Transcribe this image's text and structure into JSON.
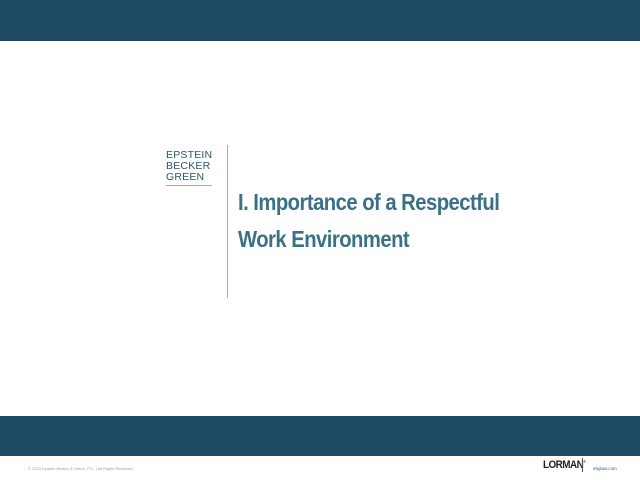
{
  "header": {
    "bar_color": "#1f4a63"
  },
  "logo": {
    "lines": [
      "EPSTEIN",
      "BECKER",
      "GREEN"
    ],
    "color": "#2a5670",
    "accent_color": "#c9a85a"
  },
  "slide": {
    "title_line1": "I. Importance of a Respectful",
    "title_line2": "Work Environment",
    "title_color": "#3a7187"
  },
  "footer": {
    "bar_color": "#1f4a63",
    "copyright": "© 2023 Epstein Becker & Green, P.C. | All Rights Reserved.",
    "lorman_logo": "LORMAN",
    "lorman_trademark": "®",
    "url": "ebglaw.com"
  }
}
